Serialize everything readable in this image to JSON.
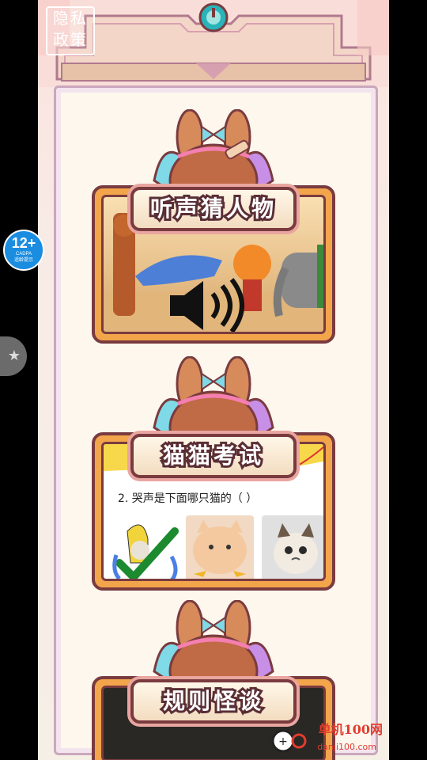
{
  "privacy_button": {
    "line1": "隐私",
    "line2": "政策"
  },
  "age_rating": {
    "age": "12+",
    "org": "CADPA",
    "note": "适龄提示"
  },
  "games": [
    {
      "title": "听声猜人物"
    },
    {
      "title": "猫猫考试",
      "question": "2. 哭声是下面哪只猫的（ ）"
    },
    {
      "title": "规则怪谈"
    }
  ],
  "watermark": {
    "main": "单机100网",
    "sub": "danji100.com"
  },
  "colors": {
    "card_border": "#7a3b3f",
    "card_fill": "#f2a54a",
    "page_bg": "#fdf7ee",
    "accent_teal": "#2ab3b8"
  }
}
